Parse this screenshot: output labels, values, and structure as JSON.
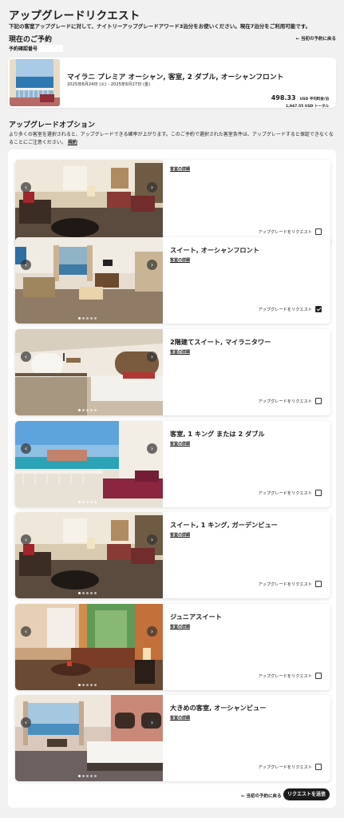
{
  "page": {
    "title": "アップグレードリクエスト",
    "intro": "下記の客室アップグレードに対して、ナイトリーアップグレードアワード3泊分をお使いください。現在7泊分をご利用可能です。"
  },
  "current_booking": {
    "heading": "現在のご予約",
    "back_link": "← 当初の予約に戻る",
    "confirmation_label": "予約確認番号",
    "confirmation_value": "",
    "room_title": "マイラニ プレミア オーシャン, 客室, 2 ダブル, オーシャンフロント",
    "dates": "2025年6月24日 (火) - 2025年6月27日 (金)",
    "price": "498.33",
    "price_unit": "USD 平均料金/泊",
    "total": "1,947.55 USD トータル"
  },
  "options": {
    "heading": "アップグレードオプション",
    "description": "より多くの客室を選択されると、アップグレードできる確率が上がります。このご予約で選択された客室条件は、アップグレードすると保証できなくなることにご注意ください。",
    "detail_link": "規約",
    "details_label": "客室の詳細",
    "request_label": "アップグレードをリクエスト",
    "rooms": [
      {
        "name": "",
        "checked": false
      },
      {
        "name": "スイート, オーシャンフロント",
        "checked": true
      },
      {
        "name": "2階建てスイート, マイラニタワー",
        "checked": false
      },
      {
        "name": "客室, 1 キング または 2 ダブル",
        "checked": false
      },
      {
        "name": "スイート, 1 キング, ガーデンビュー",
        "checked": false
      },
      {
        "name": "ジュニアスイート",
        "checked": false
      },
      {
        "name": "大きめの客室, オーシャンビュー",
        "checked": false
      }
    ]
  },
  "footer": {
    "back_link": "← 当初の予約に戻る",
    "submit_label": "リクエストを送信"
  },
  "icons": {
    "prev": "chevron-left-icon",
    "next": "chevron-right-icon",
    "back": "arrow-left-icon"
  }
}
